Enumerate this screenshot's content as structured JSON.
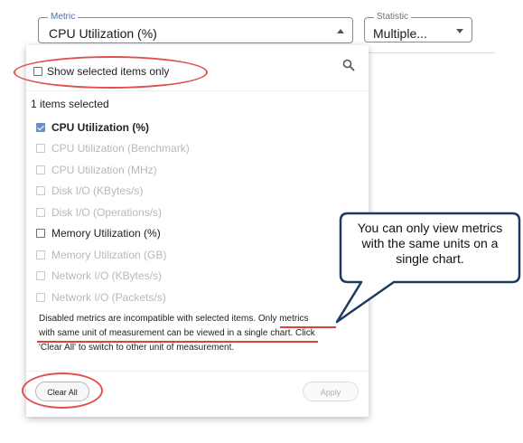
{
  "metric_field": {
    "legend": "Metric",
    "value": "CPU Utilization (%)"
  },
  "statistic_field": {
    "legend": "Statistic",
    "value": "Multiple..."
  },
  "panel": {
    "show_selected_label": "Show selected items only",
    "selected_count": "1 items selected",
    "items": [
      {
        "label": "CPU Utilization (%)",
        "state": "checked"
      },
      {
        "label": "CPU Utilization (Benchmark)",
        "state": "disabled"
      },
      {
        "label": "CPU Utilization (MHz)",
        "state": "disabled"
      },
      {
        "label": "Disk I/O (KBytes/s)",
        "state": "disabled"
      },
      {
        "label": "Disk I/O (Operations/s)",
        "state": "disabled"
      },
      {
        "label": "Memory Utilization (%)",
        "state": "enabled"
      },
      {
        "label": "Memory Utilization (GB)",
        "state": "disabled"
      },
      {
        "label": "Network I/O (KBytes/s)",
        "state": "disabled"
      },
      {
        "label": "Network I/O (Packets/s)",
        "state": "disabled"
      }
    ],
    "note_line1": "Disabled metrics are incompatible with selected items. Only metrics",
    "note_line2": "with same unit of measurement can be viewed in a single chart. Click",
    "note_line3": "'Clear All' to switch to other unit of measurement.",
    "clear_all_label": "Clear All",
    "apply_label": "Apply"
  },
  "callout": {
    "line1": "You can only view metrics",
    "line2": "with the same units on a",
    "line3": "single chart."
  },
  "colors": {
    "annotation_red": "#e0524f",
    "callout_border": "#1f3a5f",
    "checkbox_checked": "#6b8fc7"
  }
}
